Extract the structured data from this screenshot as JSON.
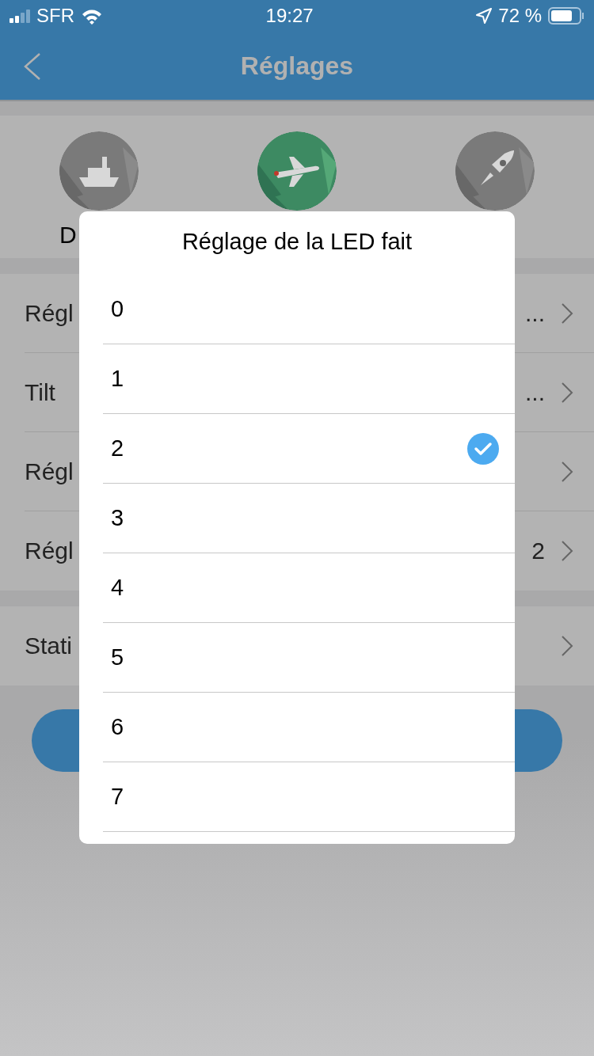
{
  "status_bar": {
    "carrier": "SFR",
    "time": "19:27",
    "battery": "72 %"
  },
  "nav": {
    "title": "Réglages"
  },
  "modes": [
    {
      "kind": "ship",
      "label": "D",
      "selected": false
    },
    {
      "kind": "plane",
      "selected": true
    },
    {
      "kind": "rocket",
      "selected": false
    }
  ],
  "settings": [
    {
      "label": "Régl",
      "value": "..."
    },
    {
      "label": "Tilt",
      "value": "..."
    },
    {
      "label": "Régl"
    },
    {
      "label": "Régl",
      "value": "2"
    }
  ],
  "extra_rows": [
    {
      "label": "Stati"
    }
  ],
  "dialog": {
    "title": "Réglage de la LED fait",
    "options": [
      {
        "label": "0",
        "selected": false
      },
      {
        "label": "1",
        "selected": false
      },
      {
        "label": "2",
        "selected": true
      },
      {
        "label": "3",
        "selected": false
      },
      {
        "label": "4",
        "selected": false
      },
      {
        "label": "5",
        "selected": false
      },
      {
        "label": "6",
        "selected": false
      },
      {
        "label": "7",
        "selected": false
      }
    ]
  }
}
